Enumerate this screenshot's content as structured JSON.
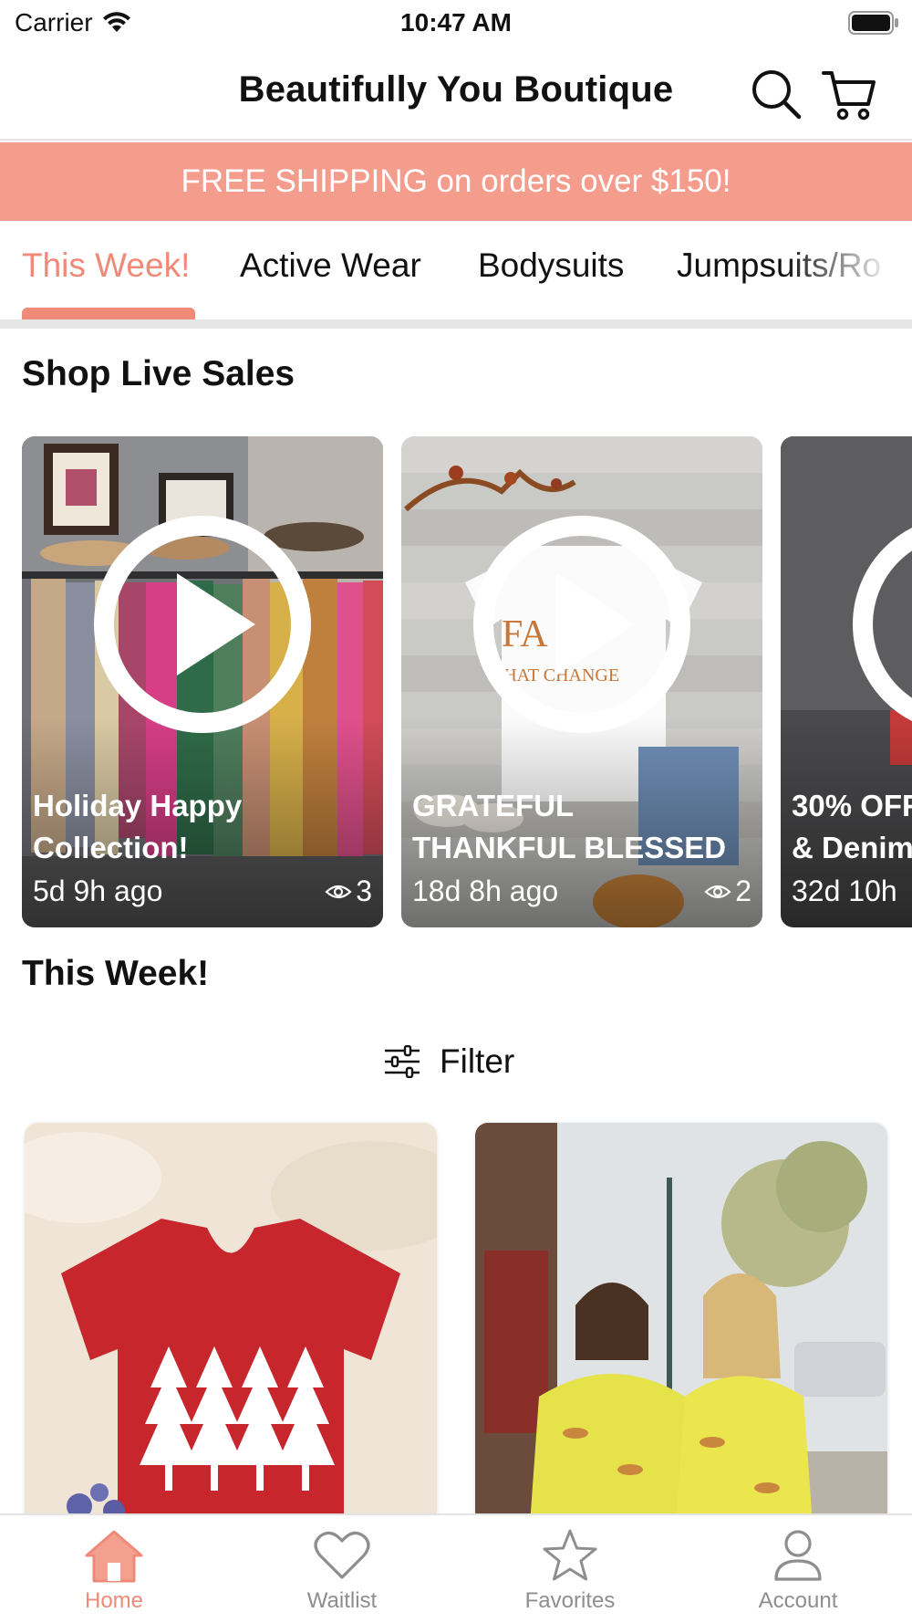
{
  "status_bar": {
    "carrier": "Carrier",
    "time": "10:47 AM"
  },
  "header": {
    "title": "Beautifully You Boutique"
  },
  "promo": {
    "text": "FREE SHIPPING on orders over $150!"
  },
  "tabs": [
    {
      "label": "This Week!",
      "active": true
    },
    {
      "label": "Active Wear",
      "active": false
    },
    {
      "label": "Bodysuits",
      "active": false
    },
    {
      "label": "Jumpsuits/Ro",
      "active": false
    }
  ],
  "live_sales": {
    "title": "Shop Live Sales",
    "cards": [
      {
        "title_line1": "Holiday Happy",
        "title_line2": "Collection!",
        "time": "5d 9h ago",
        "views": "3"
      },
      {
        "title_line1": "GRATEFUL",
        "title_line2": "THANKFUL BLESSED",
        "time": "18d 8h ago",
        "views": "2"
      },
      {
        "title_line1": "30% OFF",
        "title_line2": "& Denim",
        "time": "32d 10h",
        "views": ""
      }
    ]
  },
  "this_week": {
    "title": "This Week!",
    "filter_label": "Filter"
  },
  "bottom_nav": [
    {
      "label": "Home",
      "icon": "home-icon",
      "active": true
    },
    {
      "label": "Waitlist",
      "icon": "heart-icon",
      "active": false
    },
    {
      "label": "Favorites",
      "icon": "star-icon",
      "active": false
    },
    {
      "label": "Account",
      "icon": "person-icon",
      "active": false
    }
  ],
  "colors": {
    "accent": "#f08a78",
    "promo_bg": "#f59d8d",
    "inactive_nav": "#8e8e8e"
  }
}
